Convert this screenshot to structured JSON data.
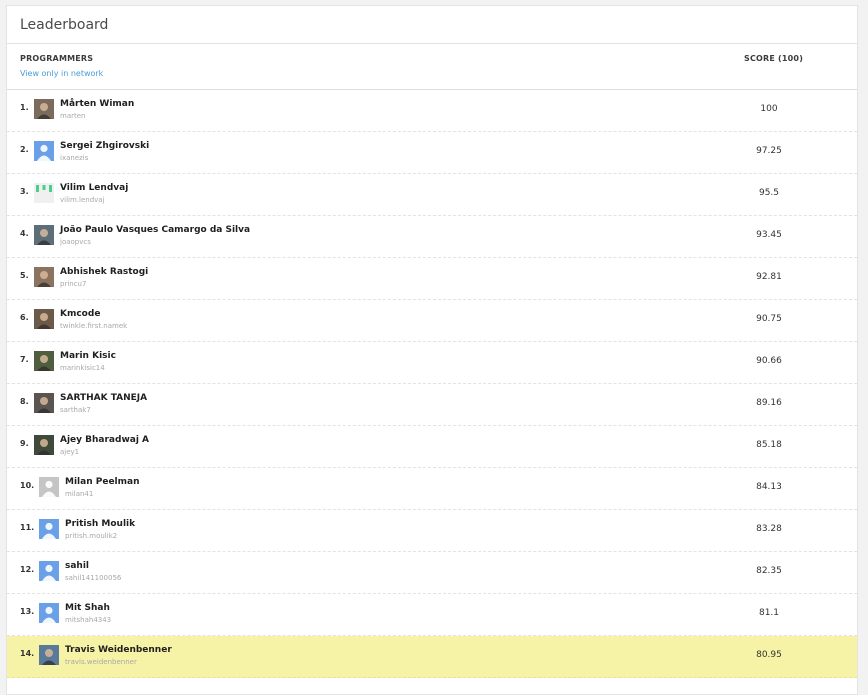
{
  "panel": {
    "title": "Leaderboard"
  },
  "header": {
    "programmers_label": "PROGRAMMERS",
    "network_link": "View only in network",
    "score_label": "SCORE (100)"
  },
  "colors": {
    "highlight_row": "#f7f3a6",
    "link": "#4a9bd8",
    "default_avatar": "#6aa0e8"
  },
  "rows": [
    {
      "rank": "1.",
      "name": "Mårten Wiman",
      "username": "marten",
      "score": "100",
      "avatar": "photo-avatar-icon"
    },
    {
      "rank": "2.",
      "name": "Sergei Zhgirovski",
      "username": "ixanezis",
      "score": "97.25",
      "avatar": "default-user-icon"
    },
    {
      "rank": "3.",
      "name": "Vilim Lendvaj",
      "username": "vilim.lendvaj",
      "score": "95.5",
      "avatar": "identicon-icon"
    },
    {
      "rank": "4.",
      "name": "João Paulo Vasques Camargo da Silva",
      "username": "joaopvcs",
      "score": "93.45",
      "avatar": "photo-avatar-icon"
    },
    {
      "rank": "5.",
      "name": "Abhishek Rastogi",
      "username": "princu7",
      "score": "92.81",
      "avatar": "photo-avatar-icon"
    },
    {
      "rank": "6.",
      "name": "Kmcode",
      "username": "twinkle.first.namek",
      "score": "90.75",
      "avatar": "photo-avatar-icon"
    },
    {
      "rank": "7.",
      "name": "Marin Kisic",
      "username": "marinkisic14",
      "score": "90.66",
      "avatar": "photo-avatar-icon"
    },
    {
      "rank": "8.",
      "name": "SARTHAK TANEJA",
      "username": "sarthak7",
      "score": "89.16",
      "avatar": "photo-avatar-icon"
    },
    {
      "rank": "9.",
      "name": "Ajey Bharadwaj A",
      "username": "ajey1",
      "score": "85.18",
      "avatar": "photo-avatar-icon"
    },
    {
      "rank": "10.",
      "name": "Milan Peelman",
      "username": "milan41",
      "score": "84.13",
      "avatar": "gray-user-icon"
    },
    {
      "rank": "11.",
      "name": "Pritish Moulik",
      "username": "pritish.moulik2",
      "score": "83.28",
      "avatar": "default-user-icon"
    },
    {
      "rank": "12.",
      "name": "sahil",
      "username": "sahil141100056",
      "score": "82.35",
      "avatar": "default-user-icon"
    },
    {
      "rank": "13.",
      "name": "Mit Shah",
      "username": "mitshah4343",
      "score": "81.1",
      "avatar": "default-user-icon"
    },
    {
      "rank": "14.",
      "name": "Travis Weidenbenner",
      "username": "travis.weidenbenner",
      "score": "80.95",
      "avatar": "photo-avatar-icon",
      "highlight": true
    }
  ]
}
